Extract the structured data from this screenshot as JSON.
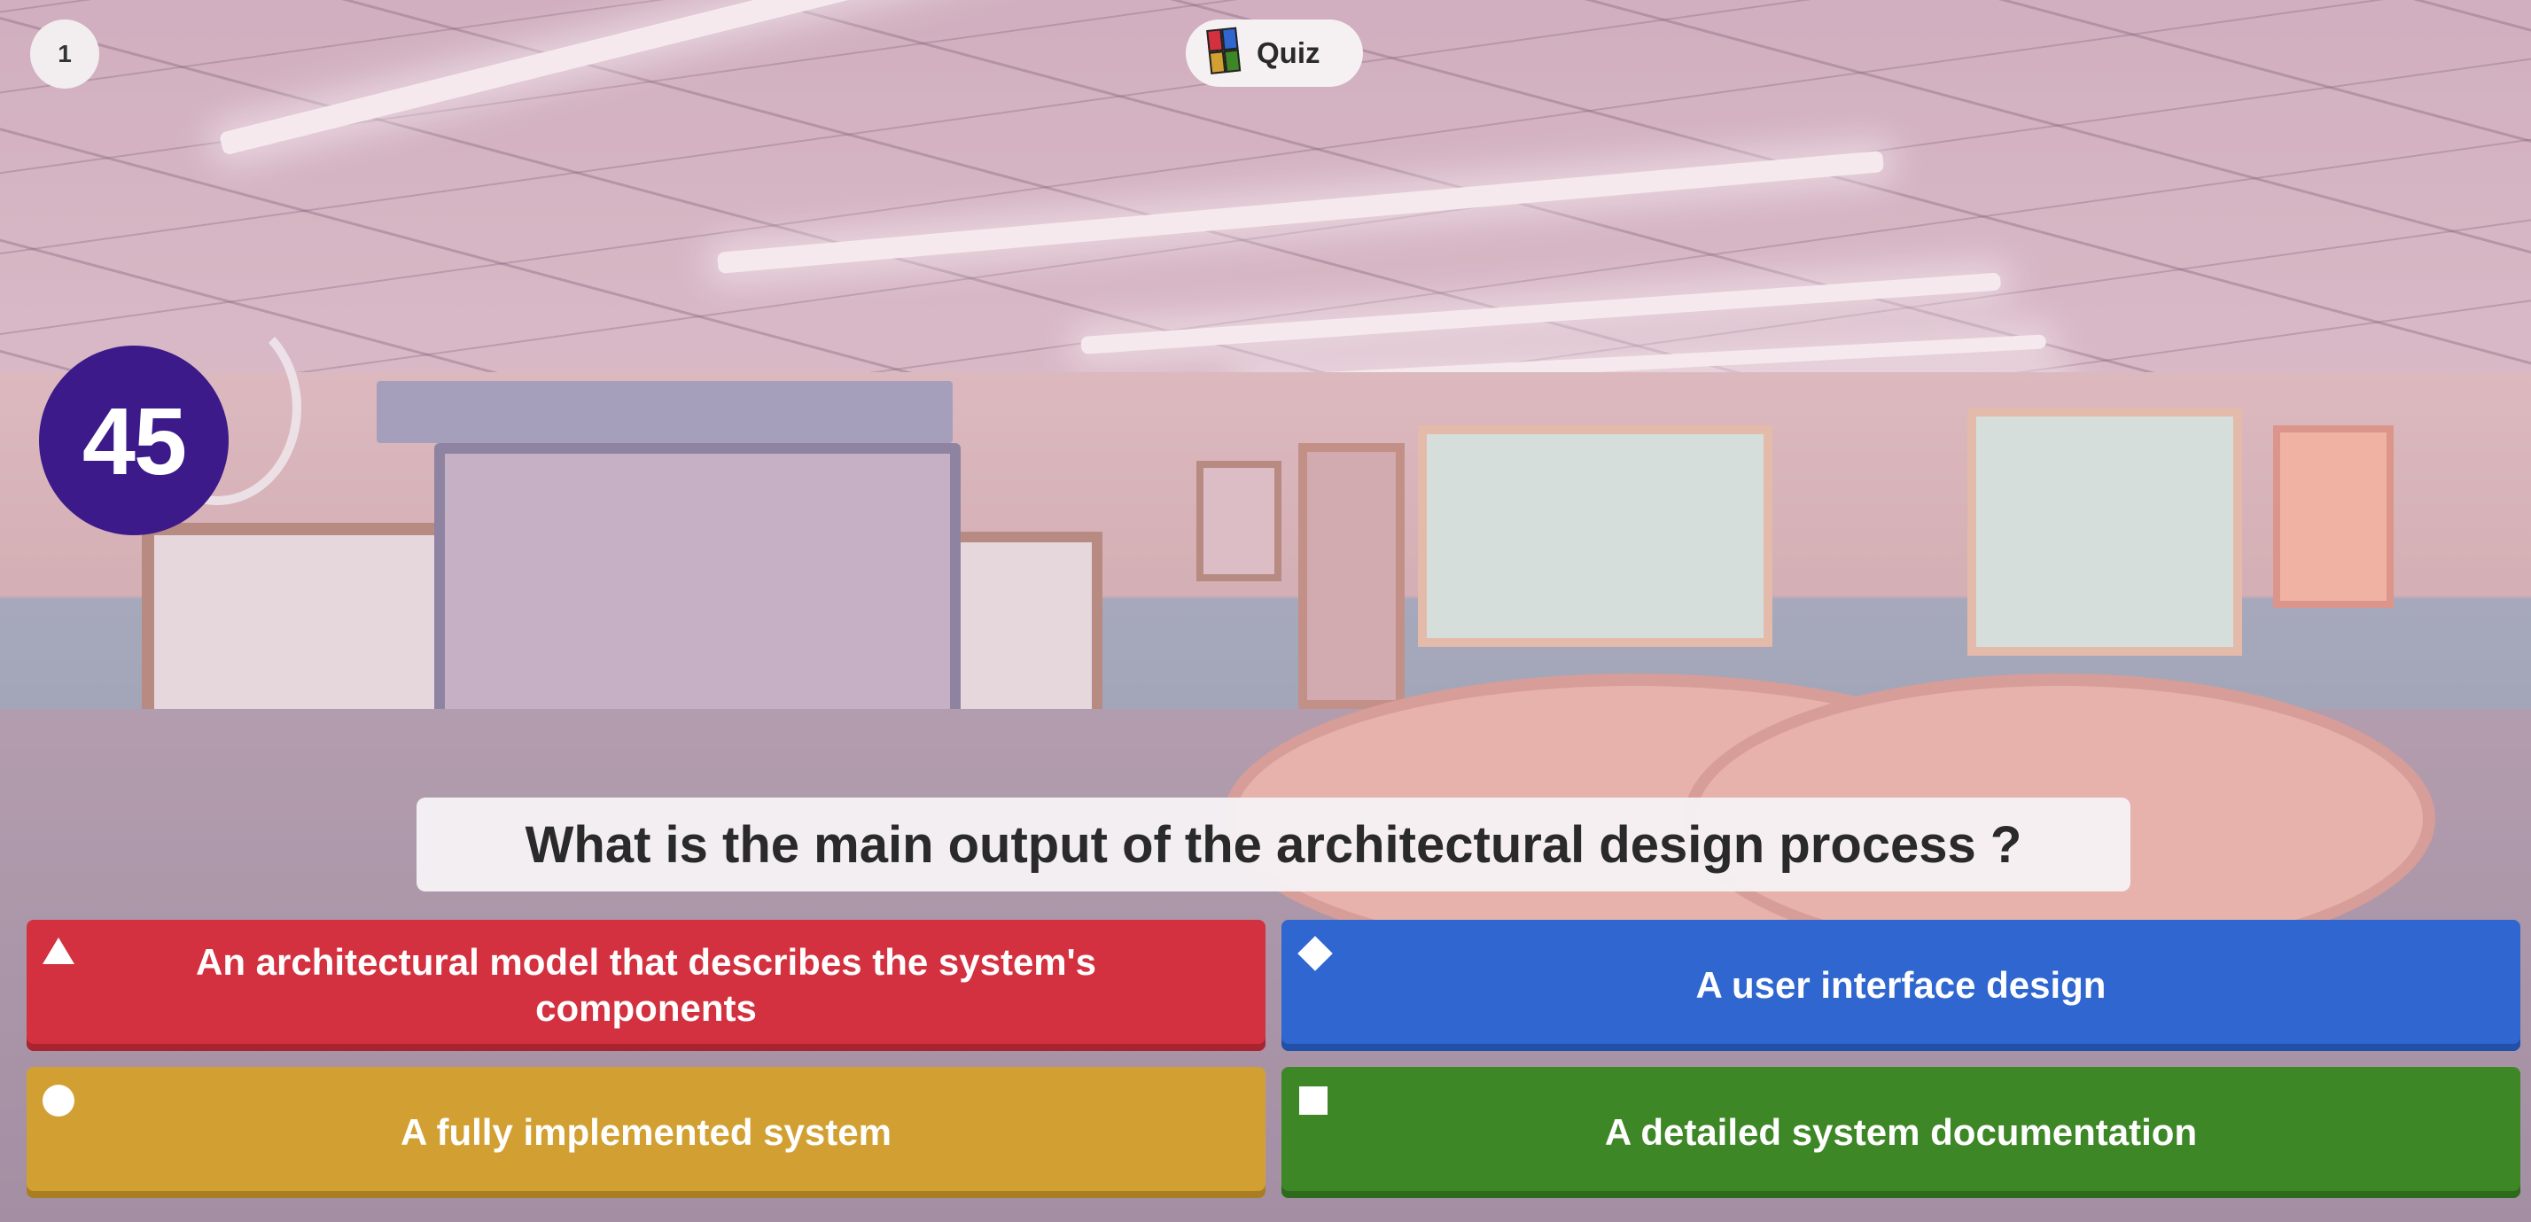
{
  "header": {
    "question_counter": "1",
    "app_label": "Quiz"
  },
  "timer": {
    "seconds_left": "45"
  },
  "question": {
    "text": "What is the main output of the architectural design process ?"
  },
  "answers": [
    {
      "text": "An architectural model that describes the system's components",
      "shape": "triangle-icon",
      "color": "#d3313f"
    },
    {
      "text": "A user interface design",
      "shape": "diamond-icon",
      "color": "#2f66cf"
    },
    {
      "text": "A fully implemented system",
      "shape": "circle-icon",
      "color": "#d2a032"
    },
    {
      "text": "A detailed system documentation",
      "shape": "square-icon",
      "color": "#3e8727"
    }
  ]
}
